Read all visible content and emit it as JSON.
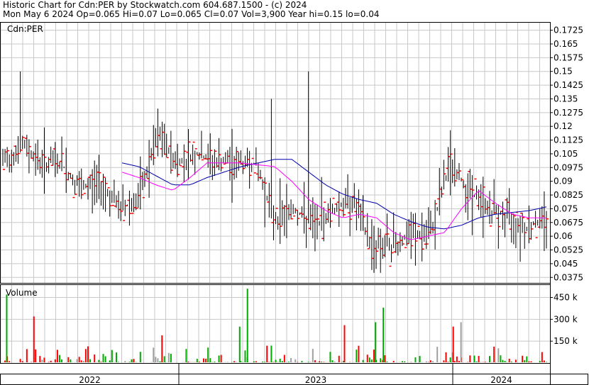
{
  "header": {
    "line1": "Historic Chart for Cdn:PER by Stockwatch.com 604.687.1500 - (c) 2024",
    "line2": "Mon May  6 2024  Op=0.065  Hi=0.07  Lo=0.065  Cl=0.07  Vol=3,900  Year hi=0.15  lo=0.04"
  },
  "colors": {
    "grid": "#c8c8c8",
    "price_bar": "#000000",
    "close_mark": "#ff0000",
    "ma_short": "#ff00ff",
    "ma_long": "#0000aa",
    "volume_up": "#00aa00",
    "volume_down": "#ff0000",
    "volume_flat": "#a0a0a0"
  },
  "chart_data": [
    {
      "type": "ohlc",
      "title": "",
      "panel_label": "Cdn:PER",
      "y_ticks": [
        "0.1725",
        "0.165",
        "0.1575",
        "0.15",
        "0.1425",
        "0.135",
        "0.1275",
        "0.12",
        "0.1125",
        "0.105",
        "0.0975",
        "0.09",
        "0.0825",
        "0.075",
        "0.0675",
        "0.06",
        "0.0525",
        "0.045",
        "0.0375"
      ],
      "ylim": [
        0.0345,
        0.177
      ],
      "x_ticks": [
        "2022",
        "2023",
        "2024"
      ],
      "grid": true,
      "summary_prices": {
        "x": [
          "2022-Jan",
          "2022-Feb",
          "2022-Mar",
          "2022-Apr",
          "2022-May",
          "2022-Jun",
          "2022-Jul",
          "2022-Aug",
          "2022-Sep",
          "2022-Oct",
          "2022-Nov",
          "2022-Dec",
          "2023-Jan",
          "2023-Feb",
          "2023-Mar",
          "2023-Apr",
          "2023-May",
          "2023-Jun",
          "2023-Jul",
          "2023-Aug",
          "2023-Sep",
          "2023-Oct",
          "2023-Nov",
          "2023-Dec",
          "2024-Jan",
          "2024-Feb",
          "2024-Mar",
          "2024-Apr",
          "2024-May"
        ],
        "close": [
          0.1,
          0.11,
          0.1,
          0.1,
          0.085,
          0.09,
          0.075,
          0.08,
          0.115,
          0.1,
          0.105,
          0.1,
          0.1,
          0.1,
          0.07,
          0.075,
          0.065,
          0.075,
          0.08,
          0.055,
          0.055,
          0.06,
          0.06,
          0.1,
          0.085,
          0.075,
          0.07,
          0.065,
          0.07
        ]
      },
      "moving_average_short": [
        0.1,
        0.1,
        0.098,
        0.095,
        0.092,
        0.088,
        0.085,
        0.092,
        0.1,
        0.1,
        0.1,
        0.099,
        0.098,
        0.09,
        0.08,
        0.074,
        0.07,
        0.072,
        0.07,
        0.062,
        0.058,
        0.06,
        0.062,
        0.075,
        0.085,
        0.078,
        0.072,
        0.07,
        0.07
      ],
      "moving_average_long": [
        0.1,
        0.1,
        0.1,
        0.1,
        0.098,
        0.093,
        0.088,
        0.088,
        0.092,
        0.095,
        0.098,
        0.1,
        0.102,
        0.102,
        0.095,
        0.088,
        0.083,
        0.08,
        0.078,
        0.072,
        0.068,
        0.065,
        0.064,
        0.066,
        0.07,
        0.072,
        0.073,
        0.074,
        0.076
      ]
    },
    {
      "type": "bar",
      "title": "",
      "panel_label": "Volume",
      "y_ticks": [
        "450 k",
        "300 k",
        "150 k"
      ],
      "ylim": [
        0,
        540000
      ],
      "notable_spikes": [
        {
          "x": "2022-Jan",
          "value": 470000,
          "direction": "up"
        },
        {
          "x": "2022-Feb",
          "value": 320000,
          "direction": "down"
        },
        {
          "x": "2022-Sep",
          "value": 190000,
          "direction": "down"
        },
        {
          "x": "2023-Jan",
          "value": 510000,
          "direction": "up"
        },
        {
          "x": "2023-Jan",
          "value": 250000,
          "direction": "up"
        },
        {
          "x": "2023-Jun",
          "value": 260000,
          "direction": "down"
        },
        {
          "x": "2023-Aug",
          "value": 280000,
          "direction": "up"
        },
        {
          "x": "2023-Aug",
          "value": 380000,
          "direction": "up"
        },
        {
          "x": "2023-Dec",
          "value": 250000,
          "direction": "down"
        },
        {
          "x": "2023-Dec",
          "value": 280000,
          "direction": "flat"
        }
      ]
    }
  ]
}
